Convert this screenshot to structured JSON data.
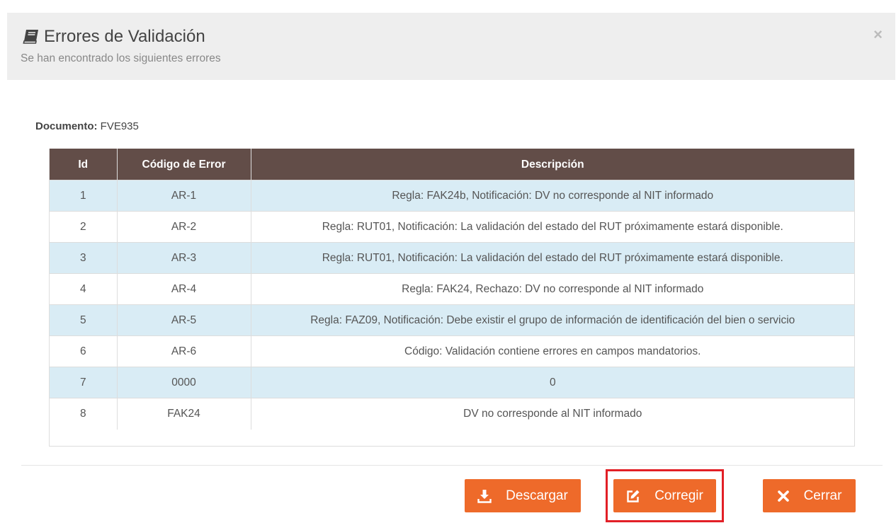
{
  "header": {
    "title": "Errores de Validación",
    "subtitle": "Se han encontrado los siguientes errores",
    "close_label": "×"
  },
  "document": {
    "label": "Documento:",
    "value": "FVE935"
  },
  "table": {
    "columns": [
      "Id",
      "Código de Error",
      "Descripción"
    ],
    "rows": [
      [
        "1",
        "AR-1",
        "Regla: FAK24b, Notificación: DV no corresponde al NIT informado"
      ],
      [
        "2",
        "AR-2",
        "Regla: RUT01, Notificación: La validación del estado del RUT próximamente estará disponible."
      ],
      [
        "3",
        "AR-3",
        "Regla: RUT01, Notificación: La validación del estado del RUT próximamente estará disponible."
      ],
      [
        "4",
        "AR-4",
        "Regla: FAK24, Rechazo: DV no corresponde al NIT informado"
      ],
      [
        "5",
        "AR-5",
        "Regla: FAZ09, Notificación: Debe existir el grupo de información de identificación del bien o servicio"
      ],
      [
        "6",
        "AR-6",
        "Código: Validación contiene errores en campos mandatorios."
      ],
      [
        "7",
        "0000",
        "0"
      ],
      [
        "8",
        "FAK24",
        "DV no corresponde al NIT informado"
      ]
    ]
  },
  "buttons": {
    "download_label": "Descargar",
    "correct_label": "Corregir",
    "close_label": "Cerrar"
  },
  "colors": {
    "header_bg": "#eeeeee",
    "table_header_bg": "#624d48",
    "row_alt_bg": "#d9ecf5",
    "button_bg": "#ee6a2a",
    "highlight_border": "#e21f26"
  },
  "icons": {
    "title": "book-icon",
    "download": "download-icon",
    "correct": "edit-icon",
    "close": "times-icon"
  }
}
